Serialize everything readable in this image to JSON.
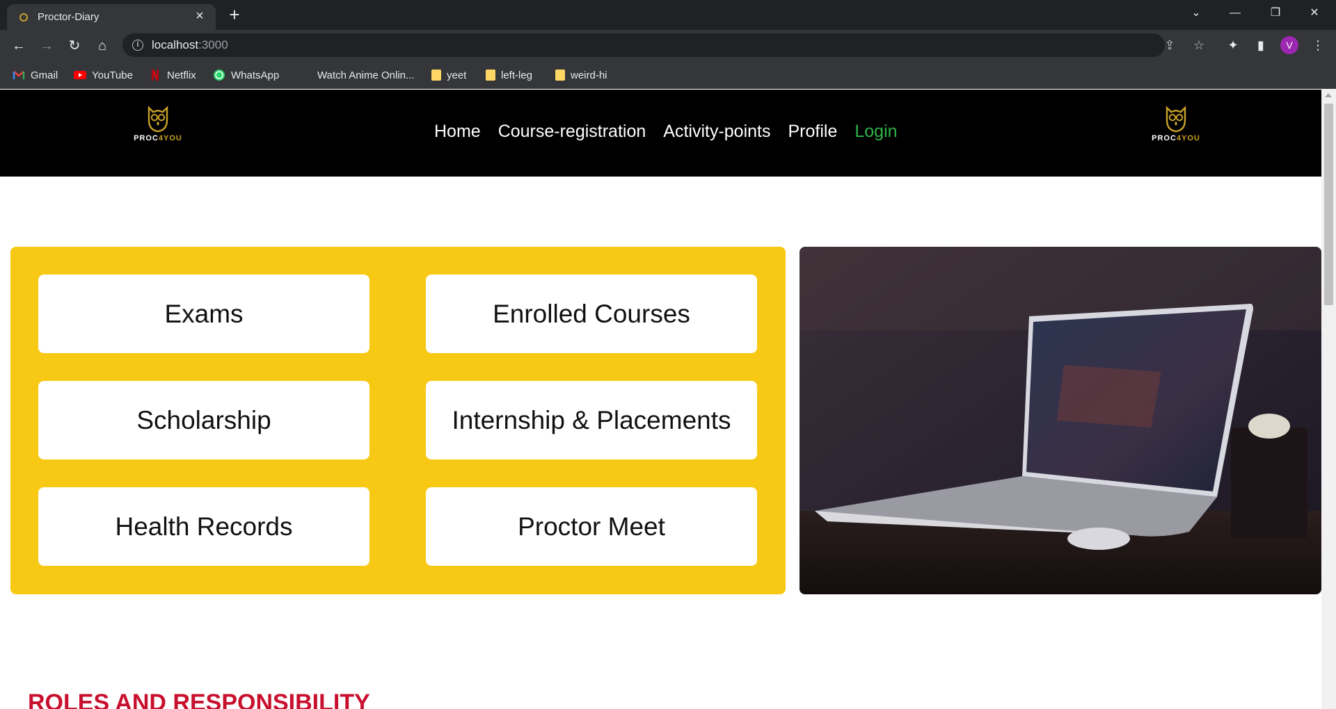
{
  "browser": {
    "tab_title": "Proctor-Diary",
    "url_host": "localhost",
    "url_port": ":3000",
    "avatar_letter": "V",
    "bookmarks": [
      {
        "label": "Gmail",
        "icon": "gmail-icon"
      },
      {
        "label": "YouTube",
        "icon": "youtube-icon"
      },
      {
        "label": "Netflix",
        "icon": "netflix-icon"
      },
      {
        "label": "WhatsApp",
        "icon": "whatsapp-icon"
      },
      {
        "label": "Watch Anime Onlin...",
        "icon": "blank-page-icon"
      },
      {
        "label": "yeet",
        "icon": "folder-icon"
      },
      {
        "label": "left-leg",
        "icon": "folder-icon"
      },
      {
        "label": "weird-hi",
        "icon": "folder-icon"
      }
    ]
  },
  "site": {
    "logo_text_1": "PROC",
    "logo_text_2": "4",
    "logo_text_3": "YOU",
    "nav": {
      "home": "Home",
      "course_registration": "Course-registration",
      "activity_points": "Activity-points",
      "profile": "Profile",
      "login": "Login"
    },
    "cards": [
      "Exams",
      "Enrolled Courses",
      "Scholarship",
      "Internship & Placements",
      "Health Records",
      "Proctor Meet"
    ],
    "section_title": "ROLES AND RESPONSIBILITY"
  },
  "colors": {
    "panel_yellow": "#f8c914",
    "login_green": "#2fb34a",
    "section_title_red": "#c8102e",
    "logo_gold": "#c9a227"
  }
}
